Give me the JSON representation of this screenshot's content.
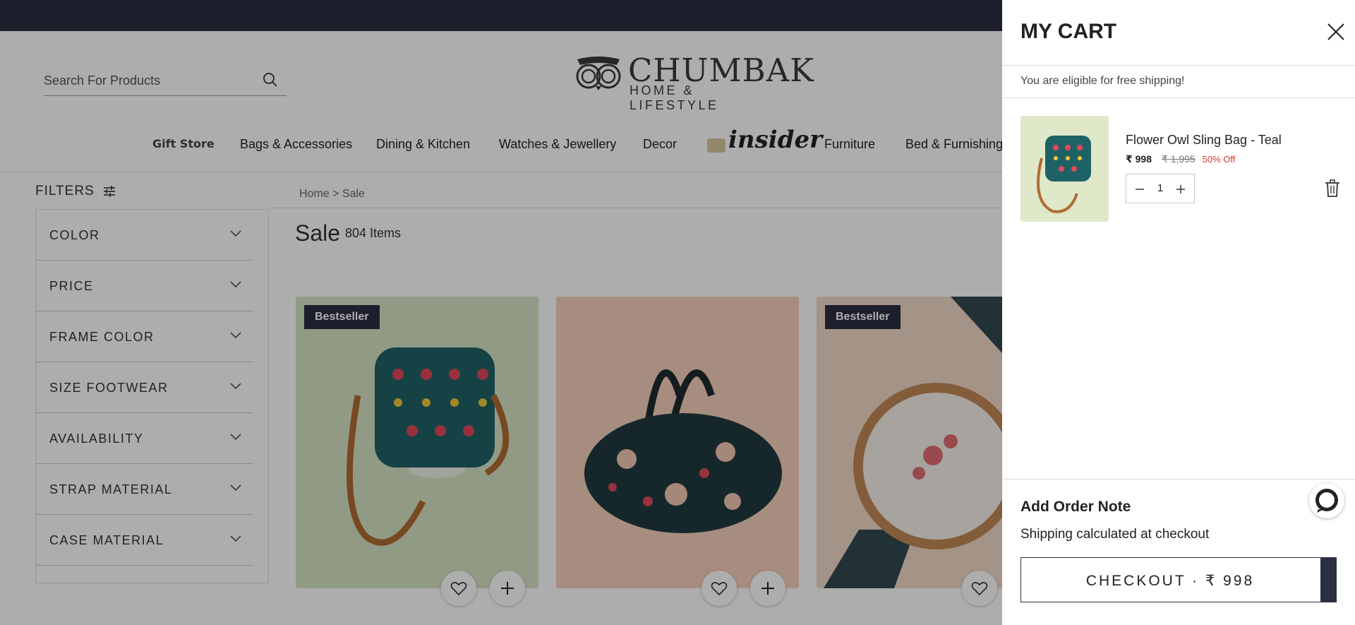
{
  "search": {
    "placeholder": "Search For Products"
  },
  "logo": {
    "name": "CHUMBAK",
    "tagline": "HOME & LIFESTYLE"
  },
  "nav": [
    {
      "label": "Gift Store"
    },
    {
      "label": "Bags & Accessories"
    },
    {
      "label": "Dining & Kitchen"
    },
    {
      "label": "Watches & Jewellery"
    },
    {
      "label": "Decor"
    },
    {
      "label": "insider"
    },
    {
      "label": "Furniture"
    },
    {
      "label": "Bed & Furnishings"
    }
  ],
  "filters": {
    "heading": "FILTERS",
    "items": [
      "COLOR",
      "PRICE",
      "FRAME COLOR",
      "SIZE FOOTWEAR",
      "AVAILABILITY",
      "STRAP MATERIAL",
      "CASE MATERIAL"
    ]
  },
  "breadcrumb": {
    "home": "Home",
    "current": "> Sale"
  },
  "listing": {
    "title": "Sale",
    "count": "804 Items"
  },
  "products": [
    {
      "badge": "Bestseller"
    },
    {
      "badge": ""
    },
    {
      "badge": "Bestseller"
    }
  ],
  "cart": {
    "title": "MY CART",
    "free_shipping": "You are eligible for free shipping!",
    "item": {
      "name": "Flower Owl Sling Bag - Teal",
      "price": "₹ 998",
      "original_price": "₹ 1,995",
      "discount": "50% Off",
      "quantity": "1"
    },
    "order_note": "Add Order Note",
    "shipping_note": "Shipping calculated at checkout",
    "checkout_label": "CHECKOUT · ₹ 998"
  },
  "colors": {
    "brand_dark": "#2c2f42",
    "discount_red": "#e0342a"
  }
}
